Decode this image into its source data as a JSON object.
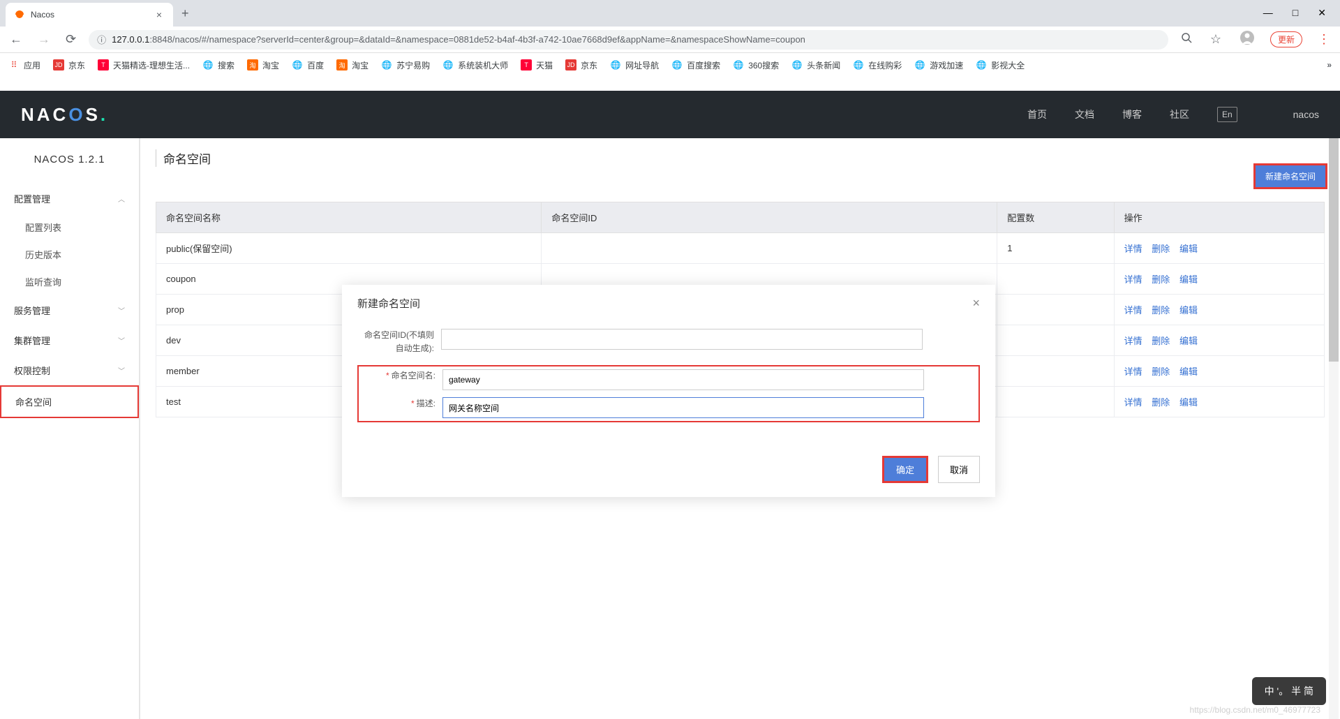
{
  "browser": {
    "tab_title": "Nacos",
    "url_host": "127.0.0.1",
    "url_port": ":8848",
    "url_path": "/nacos/#/namespace?serverId=center&group=&dataId=&namespace=0881de52-b4af-4b3f-a742-10ae7668d9ef&appName=&namespaceShowName=coupon",
    "update_label": "更新",
    "bookmarks_label": "应用",
    "bookmarks": [
      {
        "label": "京东"
      },
      {
        "label": "天猫精选-理想生活..."
      },
      {
        "label": "搜索"
      },
      {
        "label": "淘宝"
      },
      {
        "label": "百度"
      },
      {
        "label": "淘宝"
      },
      {
        "label": "苏宁易购"
      },
      {
        "label": "系统装机大师"
      },
      {
        "label": "天猫"
      },
      {
        "label": "京东"
      },
      {
        "label": "网址导航"
      },
      {
        "label": "百度搜索"
      },
      {
        "label": "360搜索"
      },
      {
        "label": "头条新闻"
      },
      {
        "label": "在线购彩"
      },
      {
        "label": "游戏加速"
      },
      {
        "label": "影视大全"
      }
    ]
  },
  "header": {
    "nav": {
      "home": "首页",
      "docs": "文档",
      "blog": "博客",
      "community": "社区",
      "lang": "En"
    },
    "user": "nacos"
  },
  "sidebar": {
    "version": "NACOS 1.2.1",
    "config_mgmt": "配置管理",
    "config_list": "配置列表",
    "history": "历史版本",
    "listener": "监听查询",
    "service_mgmt": "服务管理",
    "cluster_mgmt": "集群管理",
    "access_ctrl": "权限控制",
    "namespace": "命名空间"
  },
  "page": {
    "title": "命名空间",
    "create_btn": "新建命名空间",
    "columns": {
      "name": "命名空间名称",
      "id": "命名空间ID",
      "count": "配置数",
      "ops": "操作"
    },
    "ops": {
      "detail": "详情",
      "delete": "删除",
      "edit": "编辑"
    },
    "rows": [
      {
        "name": "public(保留空间)",
        "id": "",
        "count": "1"
      },
      {
        "name": "coupon",
        "id": "",
        "count": ""
      },
      {
        "name": "prop",
        "id": "",
        "count": ""
      },
      {
        "name": "dev",
        "id": "",
        "count": ""
      },
      {
        "name": "member",
        "id": "",
        "count": ""
      },
      {
        "name": "test",
        "id": "",
        "count": ""
      }
    ]
  },
  "modal": {
    "title": "新建命名空间",
    "id_label": "命名空间ID(不填则自动生成):",
    "id_value": "",
    "name_label": "命名空间名:",
    "name_value": "gateway",
    "desc_label": "描述:",
    "desc_value": "网关名称空间",
    "confirm": "确定",
    "cancel": "取消"
  },
  "ime": {
    "text": "中 '。 半 简"
  },
  "watermark": "https://blog.csdn.net/m0_46977723"
}
